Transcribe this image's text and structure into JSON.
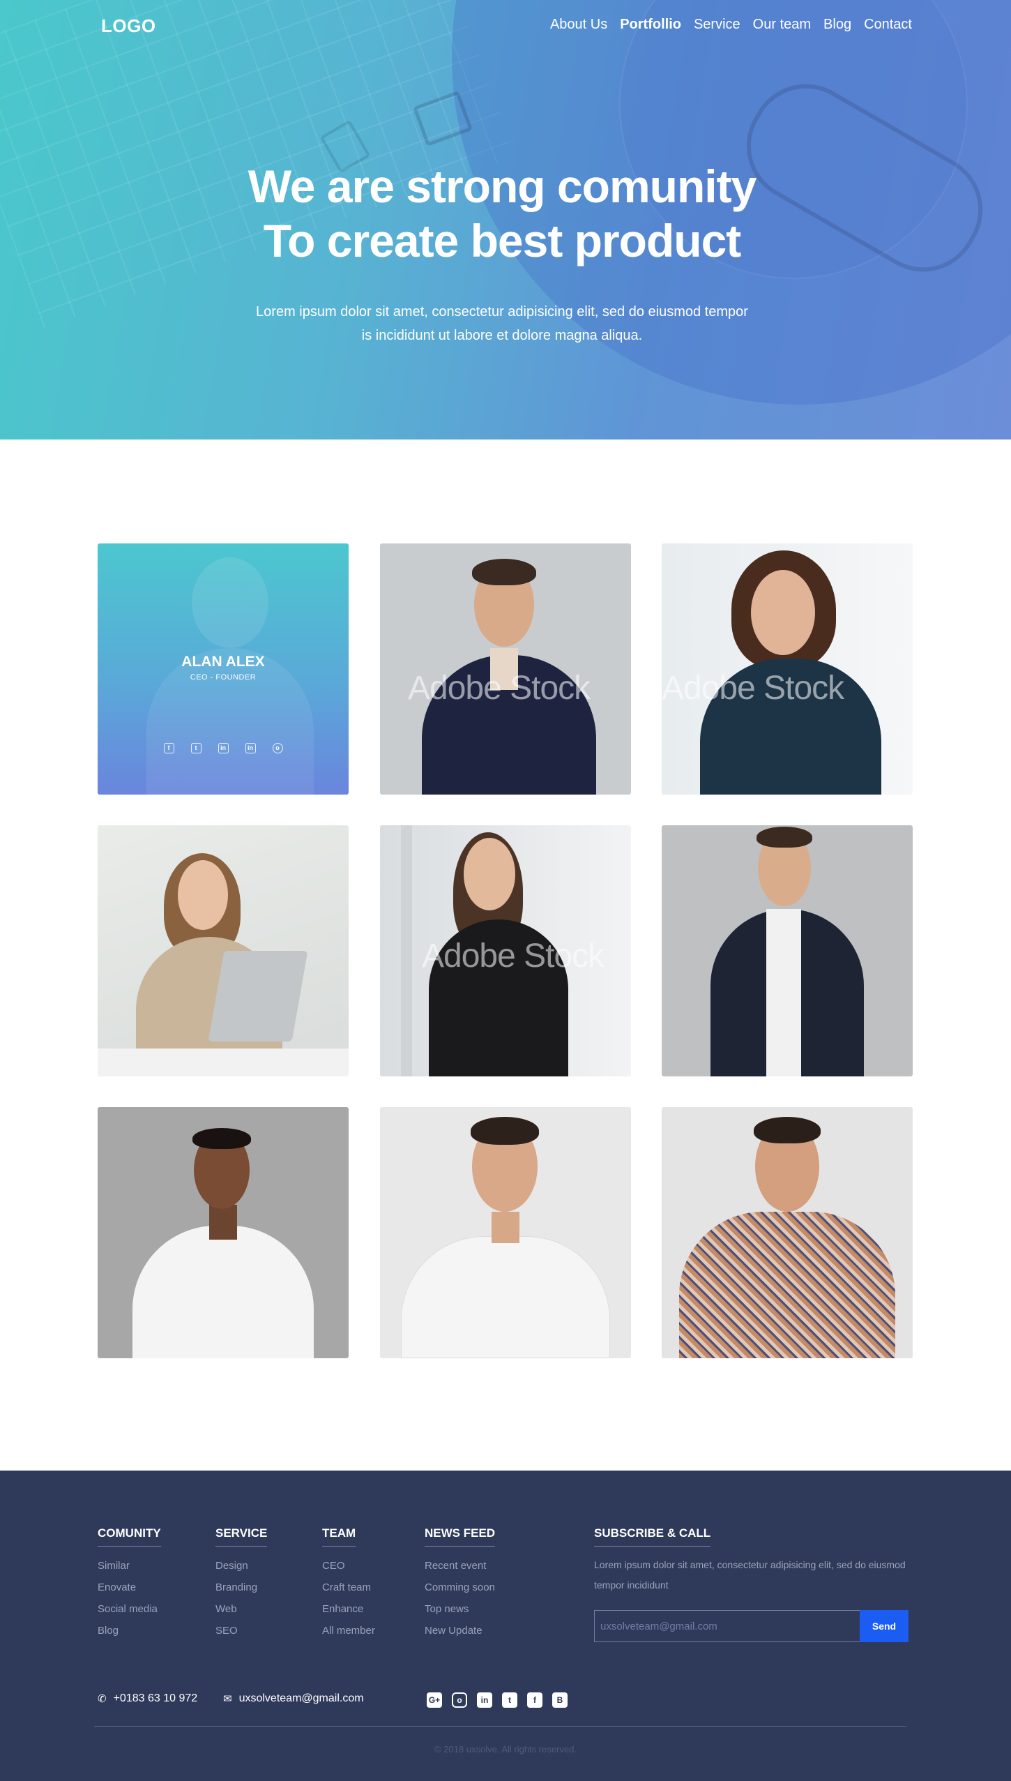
{
  "nav": {
    "logo": "LOGO",
    "items": [
      {
        "label": "About Us",
        "active": false
      },
      {
        "label": "Portfollio",
        "active": true
      },
      {
        "label": "Service",
        "active": false
      },
      {
        "label": "Our team",
        "active": false
      },
      {
        "label": "Blog",
        "active": false
      },
      {
        "label": "Contact",
        "active": false
      }
    ]
  },
  "hero": {
    "title_line1": "We are strong comunity",
    "title_line2": "To create best product",
    "subtitle_line1": "Lorem ipsum dolor sit amet, consectetur adipisicing elit, sed do eiusmod tempor",
    "subtitle_line2": "is  incididunt ut labore et dolore magna aliqua."
  },
  "team": {
    "featured": {
      "name": "ALAN ALEX",
      "role": "CEO - FOUNDER",
      "socials": [
        "facebook-icon",
        "twitter-icon",
        "linkedin-icon",
        "linkedin-square-icon",
        "instagram-icon"
      ]
    },
    "watermark": "Adobe Stock"
  },
  "footer": {
    "comunity": {
      "title": "COMUNITY",
      "links": [
        "Similar",
        "Enovate",
        "Social media",
        "Blog"
      ]
    },
    "service": {
      "title": "SERVICE",
      "links": [
        "Design",
        "Branding",
        "Web",
        "SEO"
      ]
    },
    "team": {
      "title": "TEAM",
      "links": [
        "CEO",
        "Craft team",
        "Enhance",
        "All member"
      ]
    },
    "news": {
      "title": "NEWS FEED",
      "links": [
        "Recent event",
        "Comming soon",
        "Top news",
        "New Update"
      ]
    },
    "subscribe": {
      "title": "SUBSCRIBE & CALL",
      "text": "Lorem ipsum dolor sit amet, consectetur adipisicing elit, sed do eiusmod tempor incididunt",
      "placeholder": "uxsolveteam@gmail.com",
      "button": "Send"
    },
    "phone": "+0183 63 10 972",
    "email": "uxsolveteam@gmail.com",
    "social_icons": [
      "google-plus-icon",
      "instagram-icon",
      "linkedin-icon",
      "twitter-icon",
      "facebook-icon",
      "blogger-icon"
    ],
    "copyright": "© 2018 uxsolve. All rights reserved."
  },
  "colors": {
    "hero_start": "#4ac8cb",
    "hero_end": "#6c8ed8",
    "footer_bg": "#2f3a5a",
    "send_button": "#1b5cf2"
  }
}
